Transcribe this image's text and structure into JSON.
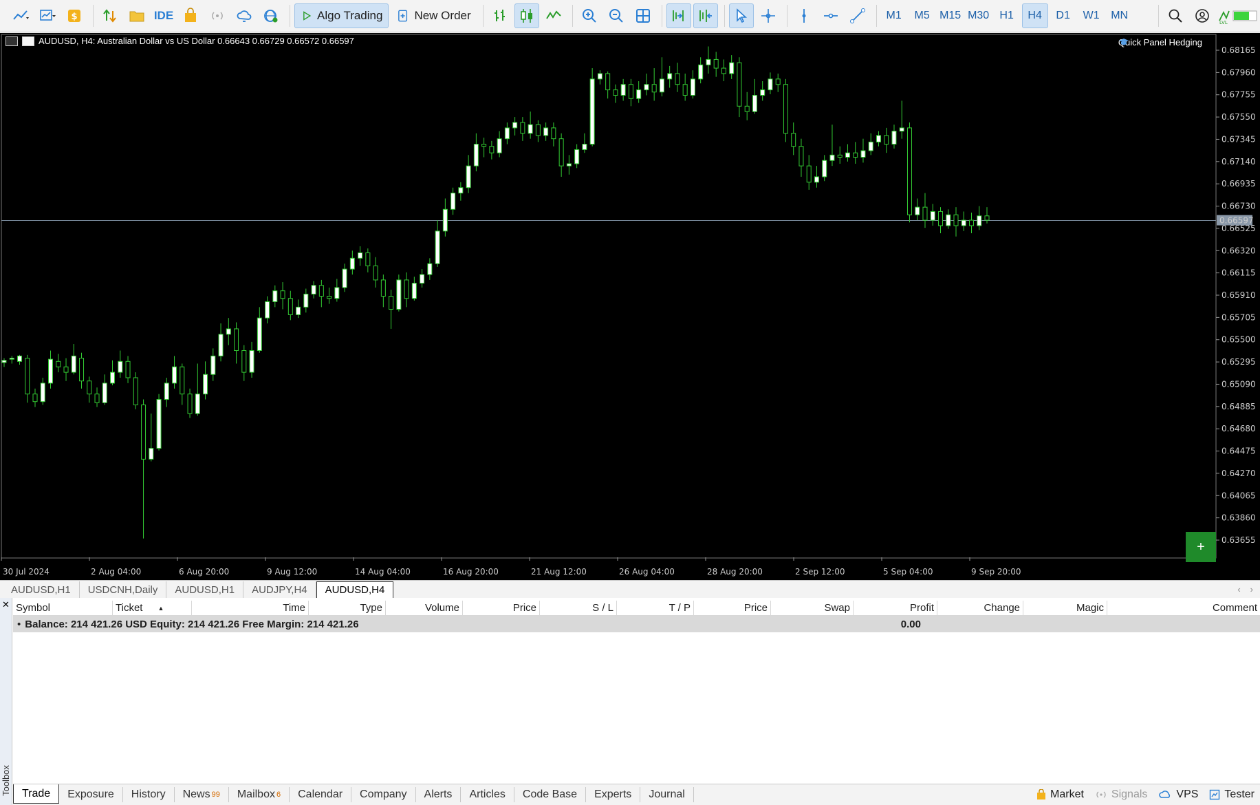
{
  "toolbar": {
    "algo_trading": "Algo Trading",
    "new_order": "New Order",
    "ide": "IDE",
    "timeframes": [
      "M1",
      "M5",
      "M15",
      "M30",
      "H1",
      "H4",
      "D1",
      "W1",
      "MN"
    ],
    "active_timeframe": "H4"
  },
  "chart": {
    "header": "AUDUSD, H4:  Australian Dollar vs US Dollar  0.66643 0.66729 0.66572 0.66597",
    "quick_panel": "Quick Panel Hedging",
    "current_price": "0.66597",
    "price_ticks": [
      "0.68165",
      "0.67960",
      "0.67755",
      "0.67550",
      "0.67345",
      "0.67140",
      "0.66935",
      "0.66730",
      "0.66525",
      "0.66320",
      "0.66115",
      "0.65910",
      "0.65705",
      "0.65500",
      "0.65295",
      "0.65090",
      "0.64885",
      "0.64680",
      "0.64475",
      "0.64270",
      "0.64065",
      "0.63860",
      "0.63655"
    ],
    "date_ticks": [
      "30 Jul 2024",
      "2 Aug 04:00",
      "6 Aug 20:00",
      "9 Aug 12:00",
      "14 Aug 04:00",
      "16 Aug 20:00",
      "21 Aug 12:00",
      "26 Aug 04:00",
      "28 Aug 20:00",
      "2 Sep 12:00",
      "5 Sep 04:00",
      "9 Sep 20:00"
    ],
    "plus_button": "+",
    "colors": {
      "background": "#000000",
      "bull": "#ffffff",
      "bear": "#000000",
      "wick": "#33cc33",
      "bid_line": "#778899"
    }
  },
  "chart_tabs": {
    "tabs": [
      "AUDUSD,H1",
      "USDCNH,Daily",
      "AUDUSD,H1",
      "AUDJPY,H4",
      "AUDUSD,H4"
    ],
    "active": "AUDUSD,H4"
  },
  "toolbox": {
    "label": "Toolbox",
    "columns": [
      "Symbol",
      "Ticket",
      "Time",
      "Type",
      "Volume",
      "Price",
      "S / L",
      "T / P",
      "Price",
      "Swap",
      "Profit",
      "Change",
      "Magic",
      "Comment"
    ],
    "balance": {
      "bullet": "•",
      "text": "Balance: 214 421.26 USD  Equity: 214 421.26  Free Margin: 214 421.26",
      "profit": "0.00"
    },
    "tabs": [
      {
        "label": "Trade"
      },
      {
        "label": "Exposure"
      },
      {
        "label": "History"
      },
      {
        "label": "News",
        "badge": "99"
      },
      {
        "label": "Mailbox",
        "badge": "6"
      },
      {
        "label": "Calendar"
      },
      {
        "label": "Company"
      },
      {
        "label": "Alerts"
      },
      {
        "label": "Articles"
      },
      {
        "label": "Code Base"
      },
      {
        "label": "Experts"
      },
      {
        "label": "Journal"
      }
    ],
    "active_tab": "Trade",
    "status": {
      "market": "Market",
      "signals": "Signals",
      "vps": "VPS",
      "tester": "Tester"
    }
  },
  "candles": [
    [
      0.6529,
      0.6531,
      0.6525,
      0.6533
    ],
    [
      0.6532,
      0.6533,
      0.6528,
      0.6535
    ],
    [
      0.653,
      0.6535,
      0.6527,
      0.6536
    ],
    [
      0.6533,
      0.65,
      0.6492,
      0.6536
    ],
    [
      0.65,
      0.6493,
      0.6488,
      0.6505
    ],
    [
      0.6493,
      0.651,
      0.649,
      0.6515
    ],
    [
      0.651,
      0.6532,
      0.6505,
      0.654
    ],
    [
      0.653,
      0.6525,
      0.652,
      0.6537
    ],
    [
      0.6525,
      0.652,
      0.6512,
      0.6533
    ],
    [
      0.652,
      0.6535,
      0.6518,
      0.6546
    ],
    [
      0.6533,
      0.6512,
      0.6505,
      0.6538
    ],
    [
      0.6512,
      0.65,
      0.6492,
      0.6516
    ],
    [
      0.65,
      0.6492,
      0.6488,
      0.6506
    ],
    [
      0.6492,
      0.651,
      0.649,
      0.6518
    ],
    [
      0.651,
      0.652,
      0.6508,
      0.6531
    ],
    [
      0.652,
      0.653,
      0.6515,
      0.654
    ],
    [
      0.653,
      0.6515,
      0.651,
      0.6535
    ],
    [
      0.6515,
      0.649,
      0.6486,
      0.652
    ],
    [
      0.649,
      0.644,
      0.6367,
      0.6495
    ],
    [
      0.644,
      0.645,
      0.6438,
      0.6482
    ],
    [
      0.645,
      0.6495,
      0.6448,
      0.65
    ],
    [
      0.6495,
      0.651,
      0.6488,
      0.6515
    ],
    [
      0.651,
      0.6525,
      0.6505,
      0.6535
    ],
    [
      0.6525,
      0.65,
      0.649,
      0.6528
    ],
    [
      0.65,
      0.6482,
      0.6478,
      0.6505
    ],
    [
      0.6482,
      0.65,
      0.648,
      0.6528
    ],
    [
      0.65,
      0.6518,
      0.6495,
      0.653
    ],
    [
      0.6518,
      0.6535,
      0.6512,
      0.6542
    ],
    [
      0.6535,
      0.6555,
      0.653,
      0.6565
    ],
    [
      0.6555,
      0.656,
      0.6545,
      0.657
    ],
    [
      0.656,
      0.654,
      0.6528,
      0.6566
    ],
    [
      0.654,
      0.652,
      0.6512,
      0.6545
    ],
    [
      0.652,
      0.654,
      0.6515,
      0.6548
    ],
    [
      0.654,
      0.657,
      0.6538,
      0.658
    ],
    [
      0.657,
      0.6585,
      0.6565,
      0.659
    ],
    [
      0.6585,
      0.6595,
      0.658,
      0.66
    ],
    [
      0.6595,
      0.6588,
      0.6578,
      0.6603
    ],
    [
      0.6588,
      0.6573,
      0.6568,
      0.6595
    ],
    [
      0.6573,
      0.658,
      0.657,
      0.6587
    ],
    [
      0.658,
      0.6592,
      0.6575,
      0.6597
    ],
    [
      0.6592,
      0.66,
      0.6588,
      0.6604
    ],
    [
      0.66,
      0.659,
      0.658,
      0.6605
    ],
    [
      0.659,
      0.6588,
      0.6583,
      0.6598
    ],
    [
      0.6588,
      0.6598,
      0.6585,
      0.6606
    ],
    [
      0.6598,
      0.6615,
      0.6594,
      0.662
    ],
    [
      0.6615,
      0.6625,
      0.661,
      0.6632
    ],
    [
      0.6625,
      0.663,
      0.6618,
      0.6636
    ],
    [
      0.663,
      0.6618,
      0.6612,
      0.6634
    ],
    [
      0.6618,
      0.6605,
      0.6598,
      0.6626
    ],
    [
      0.6605,
      0.659,
      0.658,
      0.661
    ],
    [
      0.659,
      0.6578,
      0.656,
      0.6596
    ],
    [
      0.6578,
      0.6605,
      0.6576,
      0.661
    ],
    [
      0.6605,
      0.6588,
      0.658,
      0.6612
    ],
    [
      0.6588,
      0.6602,
      0.6586,
      0.6608
    ],
    [
      0.6602,
      0.661,
      0.6598,
      0.6615
    ],
    [
      0.661,
      0.662,
      0.6605,
      0.6625
    ],
    [
      0.662,
      0.665,
      0.6617,
      0.666
    ],
    [
      0.665,
      0.667,
      0.6645,
      0.668
    ],
    [
      0.667,
      0.6685,
      0.6665,
      0.669
    ],
    [
      0.6685,
      0.669,
      0.6678,
      0.6695
    ],
    [
      0.669,
      0.671,
      0.6685,
      0.672
    ],
    [
      0.671,
      0.673,
      0.6705,
      0.674
    ],
    [
      0.673,
      0.6728,
      0.6718,
      0.6736
    ],
    [
      0.6728,
      0.6722,
      0.6716,
      0.6733
    ],
    [
      0.6722,
      0.6735,
      0.6718,
      0.6742
    ],
    [
      0.6735,
      0.6745,
      0.673,
      0.675
    ],
    [
      0.6745,
      0.675,
      0.6738,
      0.6755
    ],
    [
      0.675,
      0.674,
      0.6733,
      0.6755
    ],
    [
      0.674,
      0.6748,
      0.6735,
      0.676
    ],
    [
      0.6748,
      0.6738,
      0.6732,
      0.6752
    ],
    [
      0.6738,
      0.6745,
      0.6733,
      0.675
    ],
    [
      0.6745,
      0.6735,
      0.6728,
      0.675
    ],
    [
      0.6735,
      0.671,
      0.67,
      0.674
    ],
    [
      0.671,
      0.6712,
      0.6702,
      0.672
    ],
    [
      0.6712,
      0.6725,
      0.6708,
      0.673
    ],
    [
      0.6725,
      0.673,
      0.6722,
      0.674
    ],
    [
      0.673,
      0.679,
      0.6728,
      0.68
    ],
    [
      0.679,
      0.6795,
      0.6785,
      0.6798
    ],
    [
      0.6795,
      0.678,
      0.6772,
      0.6797
    ],
    [
      0.678,
      0.6775,
      0.6768,
      0.6785
    ],
    [
      0.6775,
      0.6785,
      0.677,
      0.679
    ],
    [
      0.6785,
      0.6772,
      0.6765,
      0.679
    ],
    [
      0.6772,
      0.678,
      0.6768,
      0.6788
    ],
    [
      0.678,
      0.6785,
      0.6775,
      0.6795
    ],
    [
      0.6785,
      0.6778,
      0.677,
      0.68
    ],
    [
      0.6778,
      0.679,
      0.6774,
      0.681
    ],
    [
      0.679,
      0.6795,
      0.6782,
      0.6802
    ],
    [
      0.6795,
      0.6785,
      0.6778,
      0.6805
    ],
    [
      0.6785,
      0.6775,
      0.677,
      0.6795
    ],
    [
      0.6775,
      0.679,
      0.6772,
      0.6798
    ],
    [
      0.679,
      0.6803,
      0.6786,
      0.681
    ],
    [
      0.6803,
      0.6808,
      0.6795,
      0.682
    ],
    [
      0.6808,
      0.68,
      0.6792,
      0.6815
    ],
    [
      0.68,
      0.6795,
      0.6788,
      0.6808
    ],
    [
      0.6795,
      0.6805,
      0.679,
      0.6812
    ],
    [
      0.6805,
      0.6765,
      0.6755,
      0.681
    ],
    [
      0.6765,
      0.676,
      0.6752,
      0.6778
    ],
    [
      0.676,
      0.6775,
      0.6758,
      0.679
    ],
    [
      0.6775,
      0.678,
      0.677,
      0.6788
    ],
    [
      0.678,
      0.679,
      0.6776,
      0.6796
    ],
    [
      0.679,
      0.6785,
      0.6778,
      0.6795
    ],
    [
      0.6785,
      0.674,
      0.6732,
      0.679
    ],
    [
      0.674,
      0.6728,
      0.672,
      0.675
    ],
    [
      0.6728,
      0.671,
      0.67,
      0.6735
    ],
    [
      0.671,
      0.6695,
      0.6688,
      0.672
    ],
    [
      0.6695,
      0.67,
      0.669,
      0.671
    ],
    [
      0.67,
      0.6715,
      0.6696,
      0.672
    ],
    [
      0.6715,
      0.672,
      0.671,
      0.6748
    ],
    [
      0.672,
      0.6718,
      0.6712,
      0.6728
    ],
    [
      0.6718,
      0.6722,
      0.6714,
      0.673
    ],
    [
      0.6722,
      0.6718,
      0.6712,
      0.6732
    ],
    [
      0.6718,
      0.6724,
      0.6713,
      0.6735
    ],
    [
      0.6724,
      0.6732,
      0.672,
      0.674
    ],
    [
      0.6732,
      0.6738,
      0.6728,
      0.6742
    ],
    [
      0.6738,
      0.673,
      0.6722,
      0.6745
    ],
    [
      0.673,
      0.6742,
      0.6726,
      0.6748
    ],
    [
      0.6742,
      0.6745,
      0.6735,
      0.677
    ],
    [
      0.6745,
      0.6665,
      0.6658,
      0.675
    ],
    [
      0.6665,
      0.6672,
      0.666,
      0.668
    ],
    [
      0.6672,
      0.666,
      0.6653,
      0.6685
    ],
    [
      0.666,
      0.6668,
      0.6655,
      0.6675
    ],
    [
      0.6668,
      0.6655,
      0.6648,
      0.6672
    ],
    [
      0.6655,
      0.6665,
      0.6652,
      0.667
    ],
    [
      0.6665,
      0.6655,
      0.6645,
      0.6672
    ],
    [
      0.6655,
      0.666,
      0.665,
      0.6668
    ],
    [
      0.666,
      0.6655,
      0.6648,
      0.6667
    ],
    [
      0.6655,
      0.6664,
      0.6651,
      0.6673
    ],
    [
      0.6664,
      0.666,
      0.6657,
      0.6672
    ]
  ]
}
